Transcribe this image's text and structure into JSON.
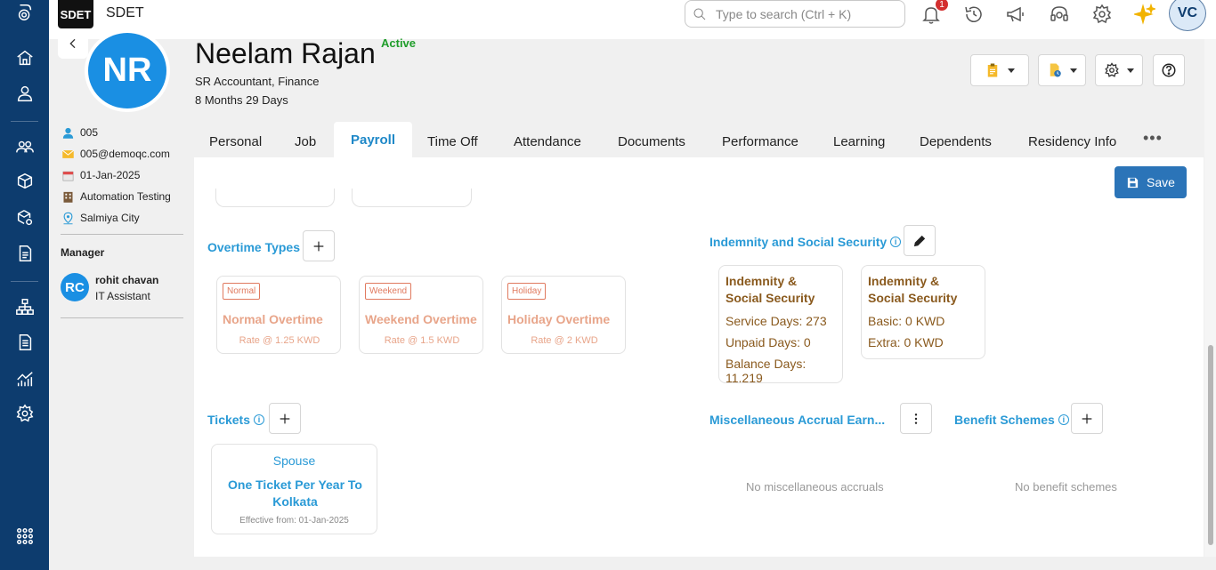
{
  "app": {
    "brand_logo": "SDET",
    "brand_name": "SDET"
  },
  "topbar": {
    "search_placeholder": "Type to search (Ctrl + K)",
    "notification_count": "1",
    "user_initials": "VC"
  },
  "profile": {
    "initials": "NR",
    "name": "Neelam Rajan",
    "status": "Active",
    "title": "SR Accountant, Finance",
    "tenure": "8 Months 29 Days",
    "employee_id": "005",
    "email": "005@demoqc.com",
    "join_date": "01-Jan-2025",
    "department": "Automation Testing",
    "location": "Salmiya City",
    "manager_label": "Manager",
    "manager": {
      "initials": "RC",
      "name": "rohit chavan",
      "role": "IT Assistant"
    }
  },
  "tabs": [
    "Personal",
    "Job",
    "Payroll",
    "Time Off",
    "Attendance",
    "Documents",
    "Performance",
    "Learning",
    "Dependents",
    "Residency Info"
  ],
  "active_tab": "Payroll",
  "actions": {
    "save_label": "Save"
  },
  "overtime": {
    "title": "Overtime Types",
    "cards": [
      {
        "tag": "Normal",
        "name": "Normal Overtime",
        "rate": "Rate @ 1.25 KWD"
      },
      {
        "tag": "Weekend",
        "name": "Weekend Overtime",
        "rate": "Rate @ 1.5 KWD"
      },
      {
        "tag": "Holiday",
        "name": "Holiday Overtime",
        "rate": "Rate @ 2 KWD"
      }
    ]
  },
  "indemnity": {
    "title": "Indemnity and Social Security",
    "cards": [
      {
        "title": "Indemnity & Social Security",
        "lines": [
          "Service Days: 273",
          "Unpaid Days: 0",
          "Balance Days: 11.219"
        ]
      },
      {
        "title": "Indemnity & Social Security",
        "lines": [
          "Basic: 0 KWD",
          "Extra: 0 KWD"
        ]
      }
    ]
  },
  "tickets": {
    "title": "Tickets",
    "card": {
      "relation": "Spouse",
      "description": "One Ticket Per Year To Kolkata",
      "effective": "Effective from: 01-Jan-2025"
    }
  },
  "misc_accrual": {
    "title": "Miscellaneous Accrual Earn...",
    "empty": "No miscellaneous accruals"
  },
  "benefits": {
    "title": "Benefit Schemes",
    "empty": "No benefit schemes"
  },
  "colors": {
    "rail": "#0d3c6e",
    "accent": "#2a9ad6",
    "save": "#2b74b8",
    "active_status": "#1f9d2a",
    "overtime": "#e8a58a",
    "indemnity": "#8a5a1e"
  }
}
